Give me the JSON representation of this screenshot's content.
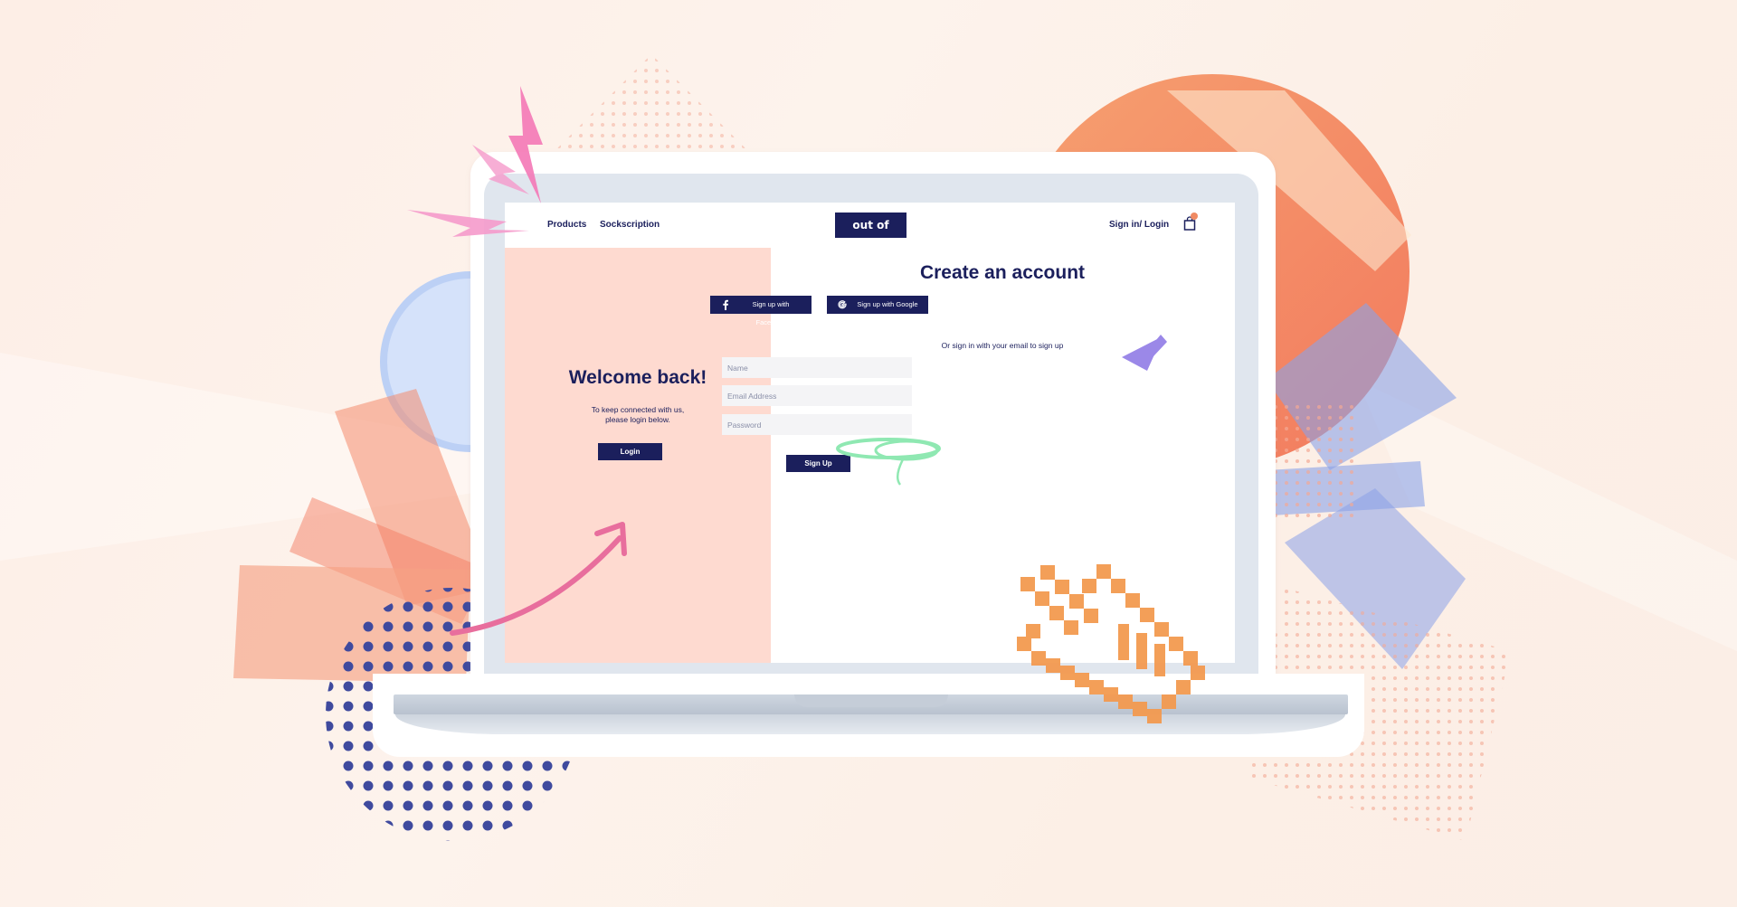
{
  "nav": {
    "products_label": "Products",
    "sockscription_label": "Sockscription",
    "logo_text": "out of sock.",
    "signin_label": "Sign in/ Login",
    "cart_icon": "shopping-bag-icon"
  },
  "left_panel": {
    "heading": "Welcome back!",
    "subtext_line1": "To keep connected with us,",
    "subtext_line2": "please login below.",
    "login_button": "Login"
  },
  "signup": {
    "title": "Create an account",
    "facebook_button": "Sign up with Facebook",
    "google_button": "Sign up with Google",
    "or_text": "Or sign in with your email to sign up",
    "name_placeholder": "Name",
    "email_placeholder": "Email Address",
    "password_placeholder": "Password",
    "signup_button": "Sign Up"
  },
  "colors": {
    "navy": "#1b1f5c",
    "peach_panel": "#fedad0",
    "accent_orange": "#f08a63"
  }
}
